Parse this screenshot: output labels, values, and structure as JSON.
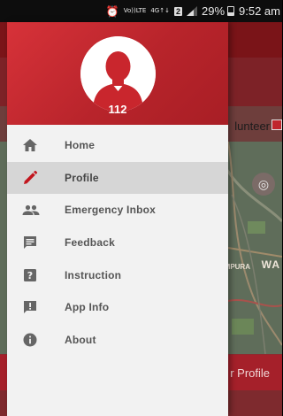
{
  "status_bar": {
    "volte_top": "Vo))",
    "volte_bottom": "LTE",
    "network_top": "4G",
    "network_bottom": "↑↓",
    "sim": "2",
    "battery": "29%",
    "time": "9:52 am"
  },
  "background": {
    "volunteer_text": "lunteer",
    "map_label_small": "MPURA",
    "map_label_large": "WA",
    "profile_button": "r Profile"
  },
  "drawer": {
    "user_id": "112",
    "items": [
      {
        "label": "Home",
        "icon": "home-icon",
        "active": false
      },
      {
        "label": "Profile",
        "icon": "pencil-icon",
        "active": true
      },
      {
        "label": "Emergency Inbox",
        "icon": "people-icon",
        "active": false
      },
      {
        "label": "Feedback",
        "icon": "feedback-icon",
        "active": false
      },
      {
        "label": "Instruction",
        "icon": "help-icon",
        "active": false
      },
      {
        "label": "App Info",
        "icon": "alert-message-icon",
        "active": false
      },
      {
        "label": "About",
        "icon": "info-icon",
        "active": false
      }
    ]
  },
  "colors": {
    "brand_red": "#c0262d",
    "active_icon": "#c2161e",
    "icon_gray": "#666666"
  }
}
